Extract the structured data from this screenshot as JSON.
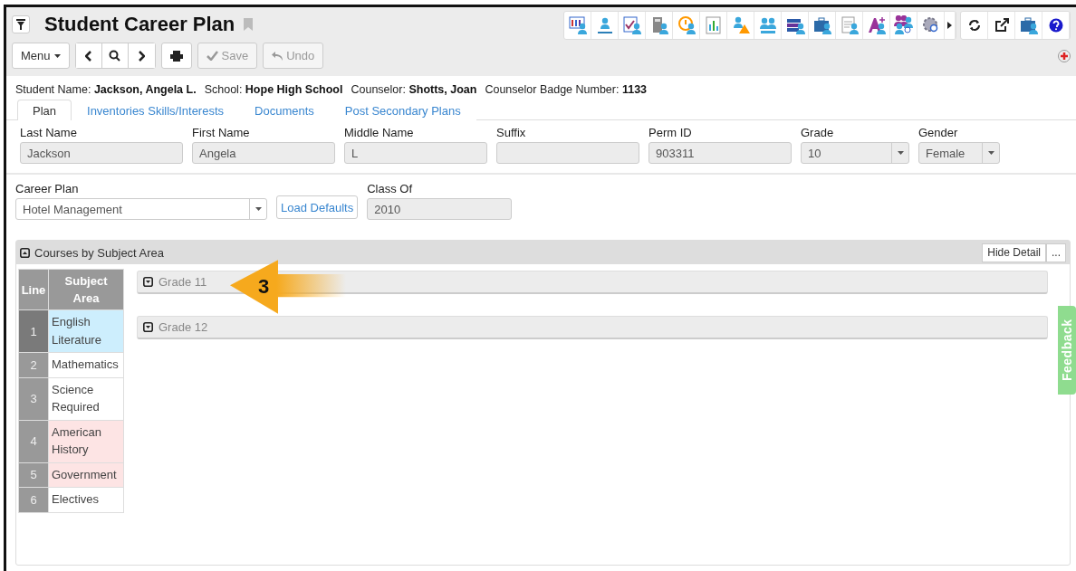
{
  "header": {
    "title": "Student Career Plan"
  },
  "toolbar": {
    "menu": "Menu",
    "save": {
      "label": "Save",
      "disabled": true
    },
    "undo": {
      "label": "Undo",
      "disabled": true
    }
  },
  "info": [
    {
      "label": "Student Name:",
      "value": "Jackson, Angela L."
    },
    {
      "label": "School:",
      "value": "Hope High School"
    },
    {
      "label": "Counselor:",
      "value": "Shotts, Joan"
    },
    {
      "label": "Counselor Badge Number:",
      "value": "1133"
    }
  ],
  "tabs": [
    {
      "label": "Plan",
      "selected": true
    },
    {
      "label": "Inventories Skills/Interests",
      "selected": false
    },
    {
      "label": "Documents",
      "selected": false
    },
    {
      "label": "Post Secondary Plans",
      "selected": false
    }
  ],
  "fields": [
    {
      "label": "Last Name",
      "value": "Jackson",
      "kind": "input"
    },
    {
      "label": "First Name",
      "value": "Angela",
      "kind": "input"
    },
    {
      "label": "Middle Name",
      "value": "L",
      "kind": "input"
    },
    {
      "label": "Suffix",
      "kind": "input"
    },
    {
      "label": "Perm ID",
      "value": "903311",
      "kind": "input"
    },
    {
      "label": "Grade",
      "value": "10",
      "kind": "select"
    },
    {
      "label": "Gender",
      "value": "Female",
      "kind": "select"
    }
  ],
  "career": {
    "label": "Career Plan",
    "value": "Hotel Management",
    "button": "Load Defaults",
    "class_label": "Class Of",
    "class_value": "2010"
  },
  "panel": {
    "title": "Courses by Subject Area",
    "hide_button": "Hide Detail",
    "more_button": "...",
    "columns": [
      "Line",
      "Subject Area"
    ],
    "rows": [
      {
        "line": "1",
        "subject": "English Literature",
        "color": "#cdeefd",
        "selected": true
      },
      {
        "line": "2",
        "subject": "Mathematics",
        "color": "#ffffff",
        "selected": false
      },
      {
        "line": "3",
        "subject": "Science Required",
        "color": "#ffffff",
        "selected": false
      },
      {
        "line": "4",
        "subject": "American History",
        "color": "#fde4e4",
        "selected": false
      },
      {
        "line": "5",
        "subject": "Government",
        "color": "#fde4e4",
        "selected": false
      },
      {
        "line": "6",
        "subject": "Electives",
        "color": "#ffffff",
        "selected": false
      }
    ],
    "grades": [
      {
        "label": "Grade 11",
        "expanded": false
      },
      {
        "label": "Grade 12",
        "expanded": false
      }
    ]
  },
  "callout": {
    "label": "3"
  },
  "feedback": "Feedback"
}
